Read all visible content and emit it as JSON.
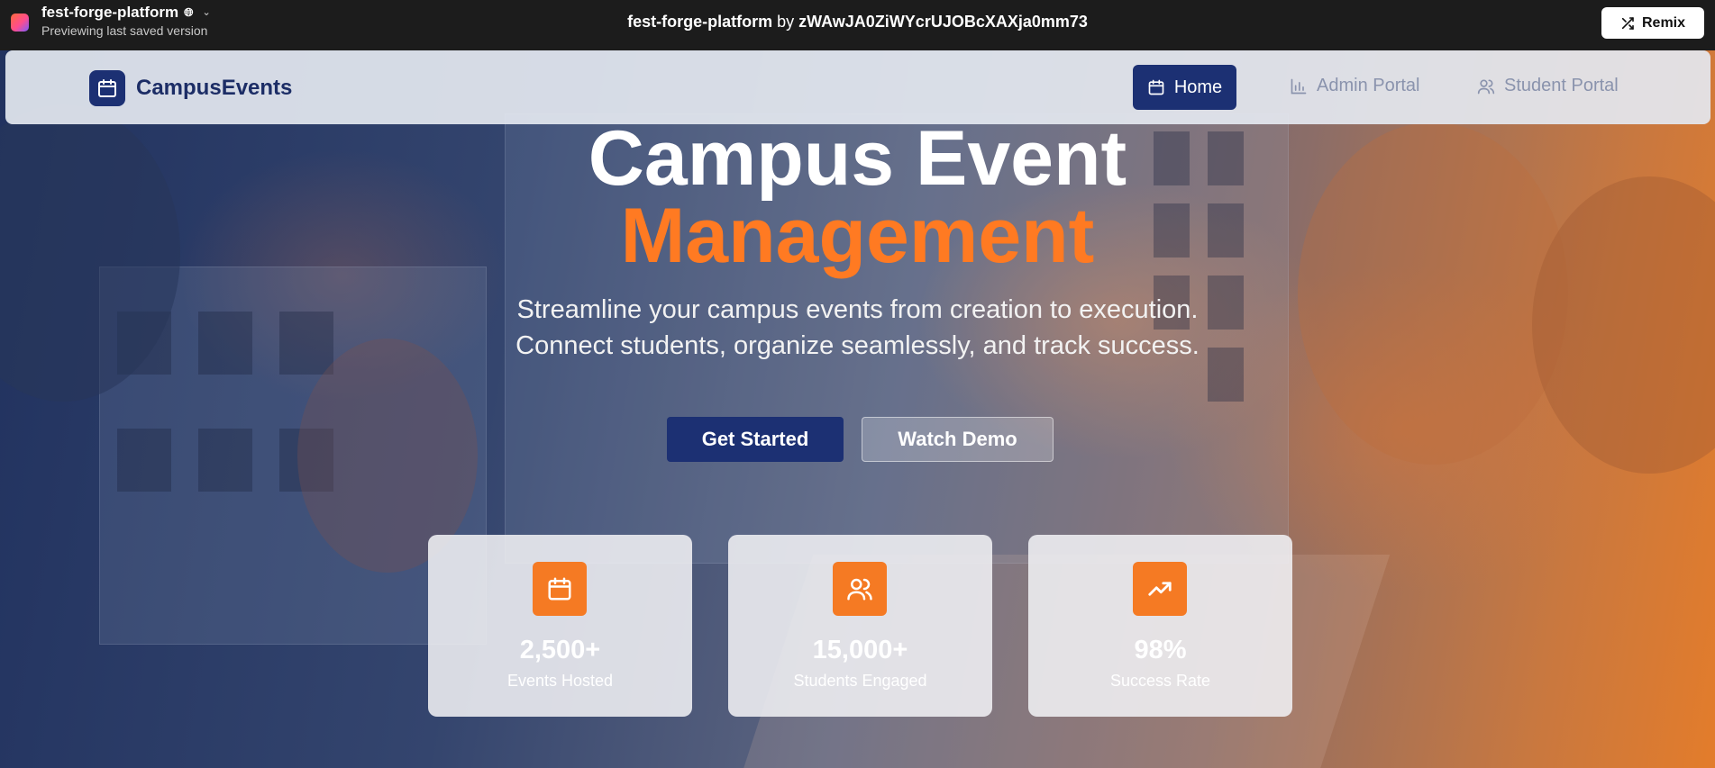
{
  "topbar": {
    "project_name": "fest-forge-platform",
    "subtitle": "Previewing last saved version",
    "title_name": "fest-forge-platform",
    "title_by": "by",
    "title_author": "zWAwJA0ZiWYcrUJOBcXAXja0mm73",
    "remix_label": "Remix"
  },
  "nav": {
    "brand": "CampusEvents",
    "items": [
      {
        "label": "Home",
        "icon": "calendar-icon",
        "active": true
      },
      {
        "label": "Admin Portal",
        "icon": "bar-chart-icon",
        "active": false
      },
      {
        "label": "Student Portal",
        "icon": "users-icon",
        "active": false
      }
    ]
  },
  "hero": {
    "title_line1": "Campus Event",
    "title_line2": "Management",
    "subtitle_line1": "Streamline your campus events from creation to execution.",
    "subtitle_line2": "Connect students, organize seamlessly, and track success.",
    "primary_button": "Get Started",
    "secondary_button": "Watch Demo"
  },
  "stats": [
    {
      "value": "2,500+",
      "label": "Events Hosted",
      "icon": "calendar-icon"
    },
    {
      "value": "15,000+",
      "label": "Students Engaged",
      "icon": "users-icon"
    },
    {
      "value": "98%",
      "label": "Success Rate",
      "icon": "trending-up-icon"
    }
  ],
  "colors": {
    "brand_navy": "#1c3073",
    "accent_orange": "#ff7a22",
    "topbar_bg": "#1c1c1c"
  }
}
